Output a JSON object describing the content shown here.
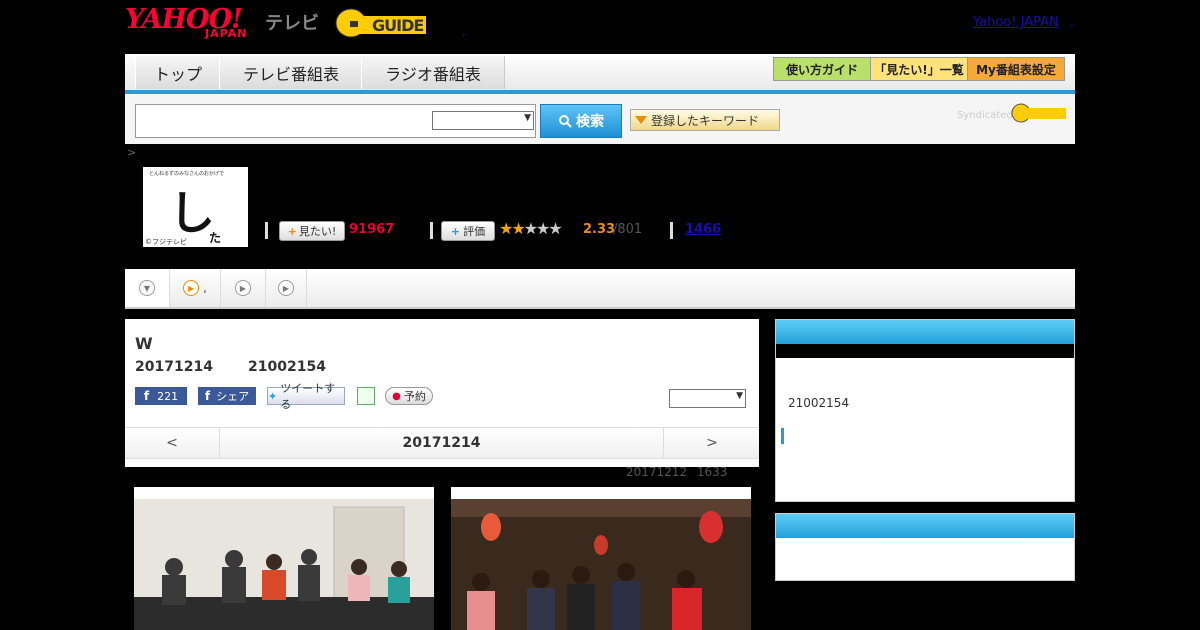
{
  "header": {
    "yahoo_logo": "YAHOO!",
    "japan_logo": "JAPAN",
    "terebi_label": "テレビ",
    "gguide_logo": "G GUIDE",
    "yahoo_japan_link": "Yahoo! JAPAN",
    "link_dot": ".",
    "comma_mark": ","
  },
  "nav": {
    "tabs": [
      {
        "label": "トップ"
      },
      {
        "label": "テレビ番組表"
      },
      {
        "label": "ラジオ番組表"
      }
    ],
    "right_buttons": [
      {
        "label": "使い方ガイド",
        "color": "#b8e06a"
      },
      {
        "label": "「見たい!」一覧",
        "color": "#ffe27a"
      },
      {
        "label": "My番組表設定",
        "color": "#f7a938"
      }
    ],
    "accent_color": "#2b9bd6"
  },
  "search": {
    "input_value": "",
    "button_label": "検索",
    "keyword_button_label": "登録したキーワード",
    "syndicated_label": "Syndicated"
  },
  "breadcrumb": ">",
  "program": {
    "thumb_caption_top": "とんねるずのみなさんのおかげで",
    "thumb_copyright": "©フジテレビ",
    "thumb_glyph": "し",
    "thumb_glyph_small": "た",
    "mitai_label": "見たい!",
    "mitai_count": "91967",
    "hyoka_label": "評価",
    "rating_value": "2.33",
    "rating_count": "/801",
    "rating_stars_filled": 2,
    "rating_stars_total": 5,
    "link_number": "1466"
  },
  "subtabs": {
    "second_label": ","
  },
  "main": {
    "title": "W",
    "date": "20171214",
    "code": "21002154",
    "fb_like_count": "221",
    "fb_share_label": "シェア",
    "tweet_label": "ツイートする",
    "reserve_label": "予約",
    "pager_prev": "<",
    "pager_date": "20171214",
    "pager_next": ">"
  },
  "updated": {
    "date": "20171212",
    "count": "1633"
  },
  "side": {
    "code": "21002154"
  }
}
